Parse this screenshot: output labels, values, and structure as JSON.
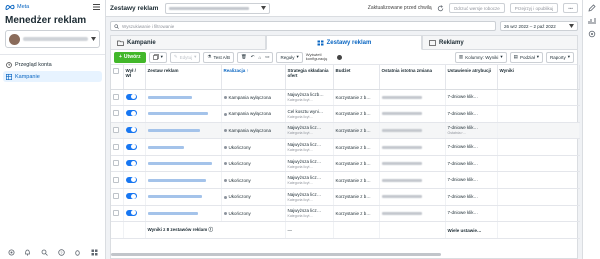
{
  "brand": "Meta",
  "app_title": "Menedżer reklam",
  "sidebar": {
    "items": [
      {
        "label": "Przegląd konta",
        "active": false
      },
      {
        "label": "Kampanie",
        "active": true
      }
    ],
    "bottom_icons": [
      "settings-icon",
      "bell-icon",
      "help-icon",
      "search-icon",
      "bug-icon",
      "grid-icon"
    ]
  },
  "topbar": {
    "title": "Zestawy reklam",
    "updated": "Zaktualizowane przed chwilą",
    "discard_label": "Odrzuć wersje robocze",
    "review_label": "Przejrzyj i opublikuj"
  },
  "search": {
    "placeholder": "Wyszukiwanie i filtrowanie"
  },
  "daterange": "26 wrz 2022 – 2 paź 2022",
  "tabs": [
    {
      "label": "Kampanie",
      "active": false
    },
    {
      "label": "Zestawy reklam",
      "active": true
    },
    {
      "label": "Reklamy",
      "active": false
    }
  ],
  "toolbar": {
    "create": "Utwórz",
    "edit": "Edytuj",
    "ab_test": "Test A/B",
    "rules": "Reguły",
    "review": "Wyświetl konfigurację",
    "columns": "Kolumny: Wyniki",
    "breakdown": "Podział",
    "reports": "Raporty"
  },
  "table": {
    "headers": {
      "onoff": "Wył / Wł",
      "name": "Zestaw reklam",
      "delivery": "Realizacja ↑",
      "bid": "Strategia składania ofert",
      "budget": "Budżet",
      "last_change": "Ostatnia istotna zmiana",
      "attribution": "Ustawienie atrybucji",
      "results": "Wyniki"
    },
    "rows": [
      {
        "delivery": "Kampania wyłączona",
        "bid": "Najwyższa liczb…",
        "bid_sub": "Kategoria licyt…",
        "budget": "Korzystanie z b…",
        "attribution": "7-dniowe klik…",
        "attribution_sub": "",
        "highlight": false
      },
      {
        "delivery": "Kampania wyłączona",
        "bid": "Cel kosztu wyni…",
        "bid_sub": "Kategoria licyt…",
        "budget": "Korzystanie z b…",
        "attribution": "7-dniowe klik…",
        "attribution_sub": "",
        "highlight": false
      },
      {
        "delivery": "Kampania wyłączona",
        "bid": "Najwyższa licz…",
        "bid_sub": "Kategoria licyt…",
        "budget": "Korzystanie z b…",
        "attribution": "7-dniowe klik…",
        "attribution_sub": "Ostatnia r…",
        "highlight": true
      },
      {
        "delivery": "Ukończony",
        "bid": "Najwyższa licz…",
        "bid_sub": "Kategoria licyt…",
        "budget": "Korzystanie z b…",
        "attribution": "7-dniowe klik…",
        "attribution_sub": "",
        "highlight": false
      },
      {
        "delivery": "Ukończony",
        "bid": "Najwyższa licz…",
        "bid_sub": "Kategoria licyt…",
        "budget": "Korzystanie z b…",
        "attribution": "7-dniowe klik…",
        "attribution_sub": "",
        "highlight": false
      },
      {
        "delivery": "Ukończony",
        "bid": "Najwyższa licz…",
        "bid_sub": "Kategoria licyt…",
        "budget": "Korzystanie z b…",
        "attribution": "7-dniowe klik…",
        "attribution_sub": "",
        "highlight": false
      },
      {
        "delivery": "Ukończony",
        "bid": "Najwyższa licz…",
        "bid_sub": "Kategoria licyt…",
        "budget": "Korzystanie z b…",
        "attribution": "7-dniowe klik…",
        "attribution_sub": "",
        "highlight": false
      },
      {
        "delivery": "Ukończony",
        "bid": "Najwyższa licz…",
        "bid_sub": "Kategoria licyt…",
        "budget": "Korzystanie z b…",
        "attribution": "7-dniowe klik…",
        "attribution_sub": "",
        "highlight": false
      }
    ],
    "summary": {
      "label": "Wyniki z 8 zestawów reklam",
      "bid": "—",
      "attribution": "Wiele ustawie…"
    }
  }
}
